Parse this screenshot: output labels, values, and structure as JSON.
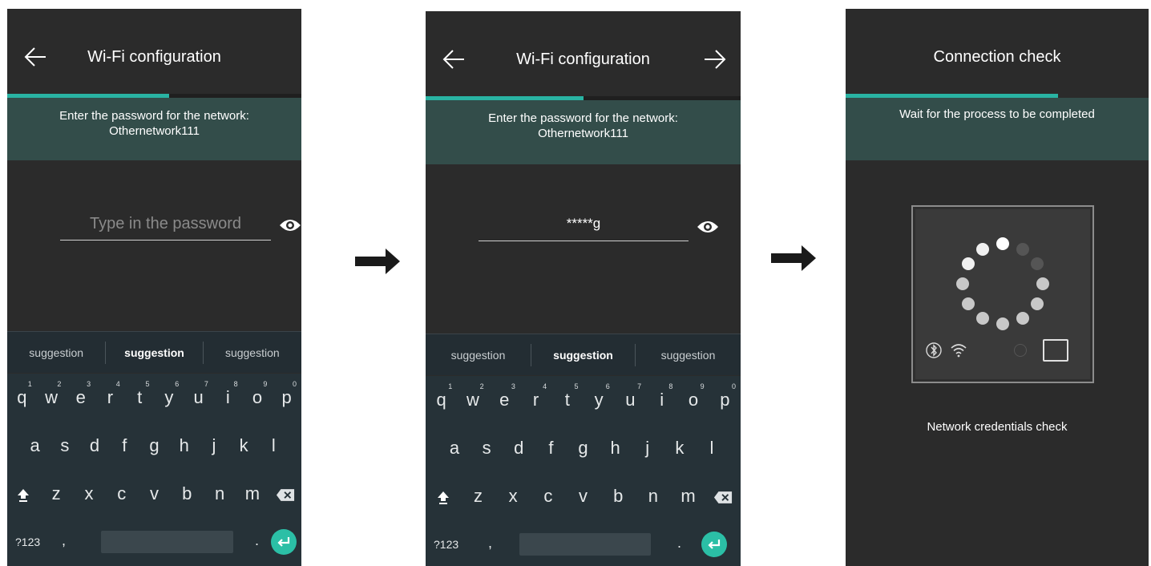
{
  "screen1": {
    "title": "Wi-Fi configuration",
    "banner_line1": "Enter the password for the network:",
    "banner_line2": "Othernetwork111",
    "password_placeholder": "Type in the password",
    "progress": 0.55
  },
  "screen2": {
    "title": "Wi-Fi configuration",
    "banner_line1": "Enter the password for the network:",
    "banner_line2": "Othernetwork111",
    "password_value": "*****g",
    "progress": 0.5
  },
  "screen3": {
    "title": "Connection check",
    "banner_line1": "Wait for the process to be completed",
    "status": "Network credentials check",
    "progress": 0.7
  },
  "keyboard": {
    "suggestions": [
      "suggestion",
      "suggestion",
      "suggestion"
    ],
    "row1": [
      "q",
      "w",
      "e",
      "r",
      "t",
      "y",
      "u",
      "i",
      "o",
      "p"
    ],
    "row1_numbers": [
      "1",
      "2",
      "3",
      "4",
      "5",
      "6",
      "7",
      "8",
      "9",
      "0"
    ],
    "row2": [
      "a",
      "s",
      "d",
      "f",
      "g",
      "h",
      "j",
      "k",
      "l"
    ],
    "row3": [
      "z",
      "x",
      "c",
      "v",
      "b",
      "n",
      "m"
    ],
    "symbols_key": "?123",
    "comma_key": ",",
    "period_key": "."
  },
  "colors": {
    "accent": "#29b3a3",
    "banner": "#334d4a",
    "background": "#2b2b2b",
    "keyboard": "#263238",
    "enter_key": "#2bbfa6"
  },
  "icons": [
    "back-arrow-icon",
    "forward-arrow-icon",
    "eye-icon",
    "shift-icon",
    "backspace-icon",
    "enter-icon",
    "bluetooth-icon",
    "wifi-icon",
    "flow-arrow-icon"
  ]
}
